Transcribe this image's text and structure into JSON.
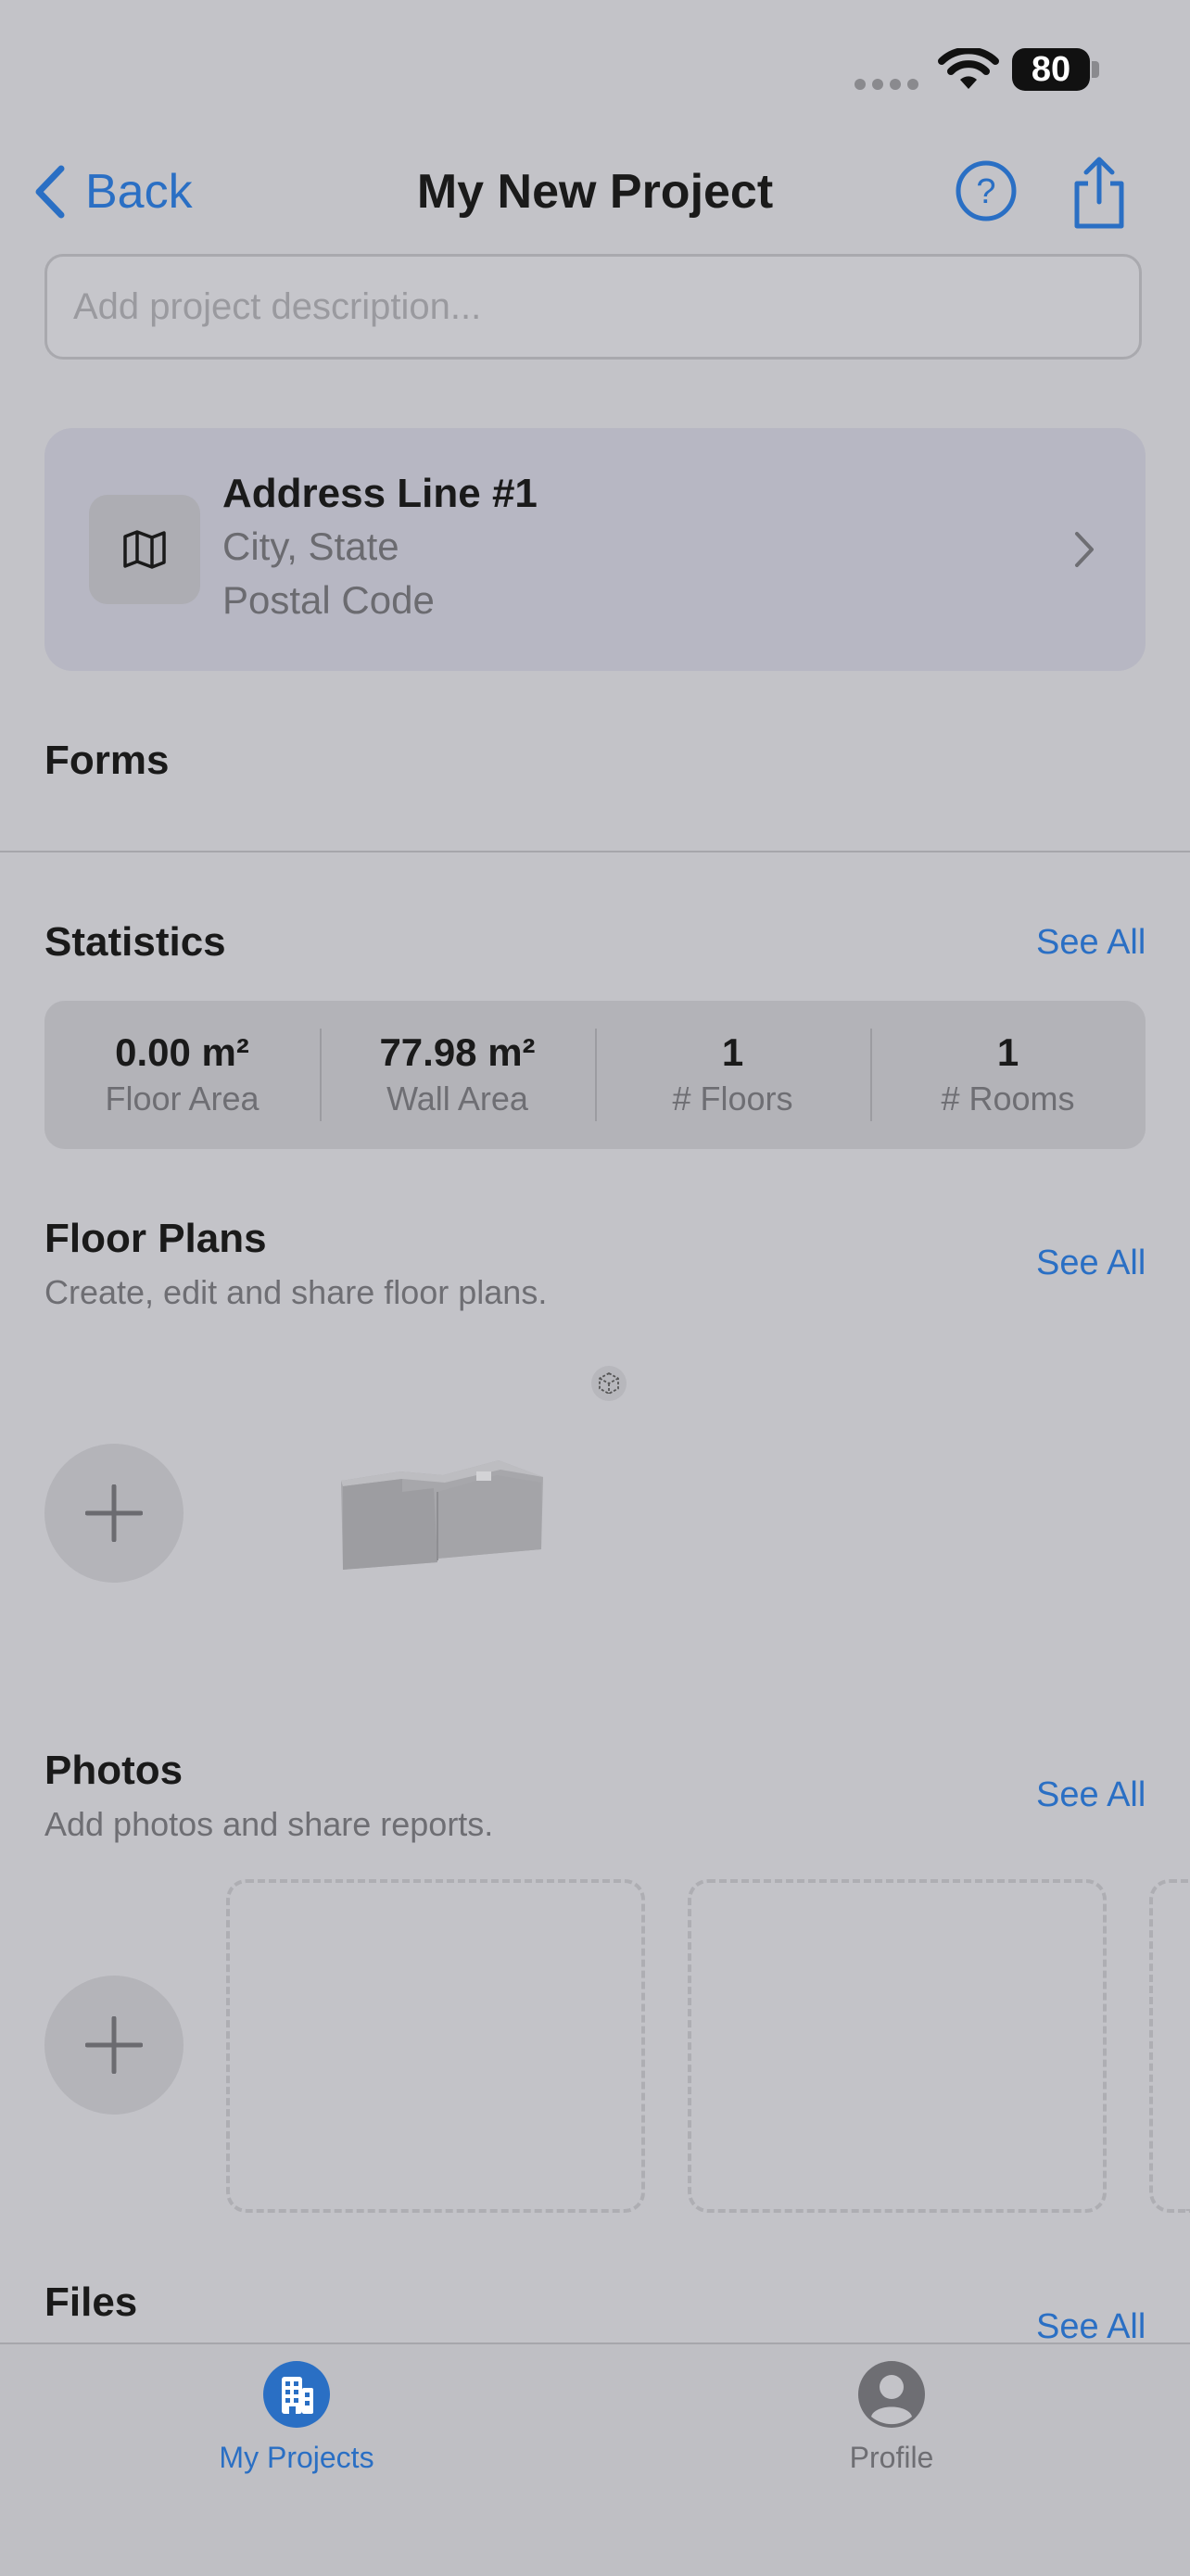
{
  "status_bar": {
    "battery": "80"
  },
  "nav": {
    "back_label": "Back",
    "title": "My New Project"
  },
  "description": {
    "placeholder": "Add project description..."
  },
  "address": {
    "line1": "Address Line #1",
    "line2": "City, State",
    "line3": "Postal Code"
  },
  "forms": {
    "title": "Forms"
  },
  "statistics": {
    "title": "Statistics",
    "see_all": "See All",
    "items": [
      {
        "value": "0.00 m²",
        "label": "Floor Area"
      },
      {
        "value": "77.98 m²",
        "label": "Wall Area"
      },
      {
        "value": "1",
        "label": "# Floors"
      },
      {
        "value": "1",
        "label": "# Rooms"
      }
    ]
  },
  "floor_plans": {
    "title": "Floor Plans",
    "subtitle": "Create, edit and share floor plans.",
    "see_all": "See All"
  },
  "photos": {
    "title": "Photos",
    "subtitle": "Add photos and share reports.",
    "see_all": "See All"
  },
  "files": {
    "title": "Files",
    "see_all": "See All"
  },
  "tab_bar": {
    "tabs": [
      {
        "label": "My Projects",
        "icon": "building-icon",
        "active": true
      },
      {
        "label": "Profile",
        "icon": "person-icon",
        "active": false
      }
    ]
  },
  "colors": {
    "accent": "#2a6fc4",
    "background": "#c3c3c8"
  }
}
